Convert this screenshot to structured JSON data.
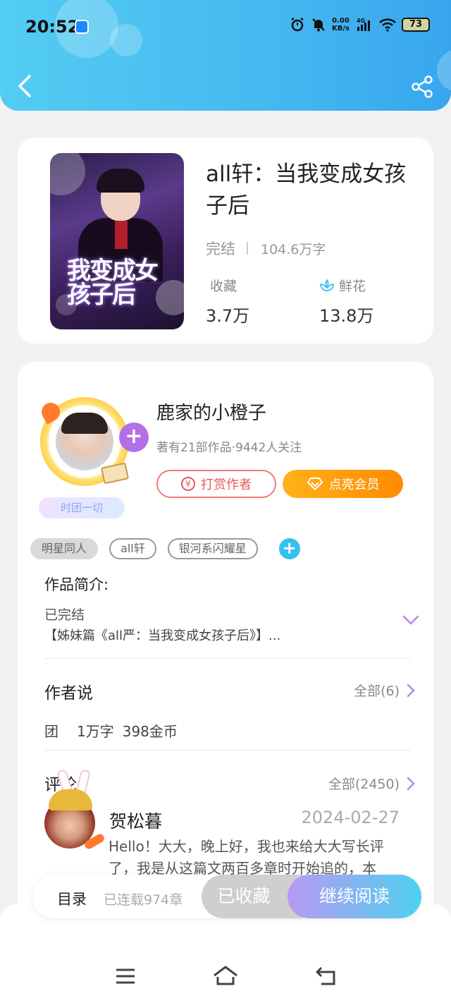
{
  "status_bar": {
    "time": "20:52",
    "net_speed_value": "0.00",
    "net_speed_unit": "KB/s",
    "network": "4G",
    "battery": "73"
  },
  "header": {
    "back_icon": "chevron-left-icon",
    "share_icon": "share-icon"
  },
  "book": {
    "title": "all轩：当我变成女孩子后",
    "status": "完结",
    "word_count": "104.6万字",
    "favorites_label": "收藏",
    "favorites_value": "3.7万",
    "flowers_label": "鲜花",
    "flowers_value": "13.8万",
    "cover_title_art": "我变成女孩子后"
  },
  "author": {
    "name": "鹿家的小橙子",
    "meta": "著有21部作品·9442人关注",
    "badge": "时团一切",
    "tip_button": "打赏作者",
    "vip_button": "点亮会员"
  },
  "tags": [
    "明星同人",
    "all轩",
    "银河系闪耀星"
  ],
  "intro": {
    "title": "作品简介:",
    "status": "已完结",
    "text": "【姊妹篇《all严：当我变成女孩子后》】..."
  },
  "author_says": {
    "title": "作者说",
    "more": "全部(6)",
    "items": [
      "团",
      "1万字",
      "398金币"
    ]
  },
  "comments": {
    "title": "评论",
    "more": "全部(2450)",
    "first": {
      "user": "贺松暮",
      "date": "2024-02-27",
      "text": "Hello！大大，晚上好，我也来给大大写长评了，我是从这篇文两百多章时开始追的，本"
    }
  },
  "action_bar": {
    "toc_label": "目录",
    "toc_meta": "已连载974章",
    "favorited_button": "已收藏",
    "continue_button": "继续阅读"
  },
  "colors": {
    "header_start": "#53cdf2",
    "header_end": "#38a6ee",
    "vip_orange": "#ff8a00",
    "tip_red": "#e85a5a",
    "follow_purple": "#b56fe6"
  }
}
